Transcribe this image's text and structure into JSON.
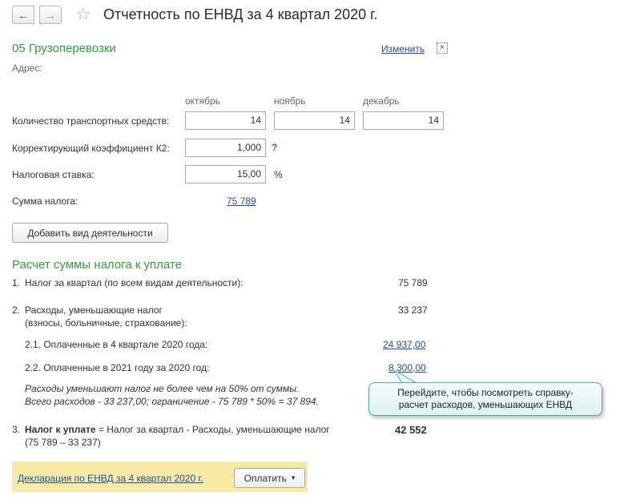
{
  "header": {
    "title": "Отчетность по ЕНВД за 4 квартал 2020 г."
  },
  "activity": {
    "name": "05 Грузоперевозки",
    "change_link": "Изменить",
    "close_glyph": "×",
    "address_label": "Адрес:",
    "months": [
      "октябрь",
      "ноябрь",
      "декабрь"
    ],
    "vehicles_label": "Количество транспортных средств:",
    "vehicles": [
      "14",
      "14",
      "14"
    ],
    "k2_label": "Корректирующий коэффициент К2:",
    "k2_value": "1,000",
    "k2_help": "?",
    "rate_label": "Налоговая ставка:",
    "rate_value": "15,00",
    "rate_unit": "%",
    "tax_sum_label": "Сумма налога:",
    "tax_sum_value": "75 789",
    "add_button": "Добавить вид деятельности"
  },
  "calc": {
    "title": "Расчет суммы налога к уплате",
    "item1_num": "1.",
    "item1_label": "Налог за квартал (по всем видам деятельности):",
    "item1_value": "75 789",
    "item2_num": "2.",
    "item2_label_line1": "Расходы, уменьшающие налог",
    "item2_label_line2": "(взносы, больничные, страхование):",
    "item2_value": "33 237",
    "item21_label": "2.1.  Оплаченные в 4 квартале 2020 года:",
    "item21_value": "24 937,00",
    "item22_label": "2.2.  Оплаченные в 2021 году за 2020 год:",
    "item22_value": "8 300,00",
    "note_line1": "Расходы уменьшают налог не более чем на 50% от суммы.",
    "note_line2": "Всего расходов - 33 237,00; ограничение - 75 789 * 50% = 37 894.",
    "item3_num": "3.",
    "item3_bold": "Налог к уплате",
    "item3_rest": " = Налог за квартал - Расходы, уменьшающие налог",
    "item3_line2": "(75 789 – 33 237)",
    "item3_value": "42 552"
  },
  "tooltip": {
    "line1": "Перейдите, чтобы посмотреть справку-",
    "line2": "расчет расходов, уменьшающих ЕНВД"
  },
  "footer": {
    "declaration_link": "Декларация по ЕНВД за 4 квартал 2020 г.",
    "pay_button": "Оплатить",
    "pay_arrow": "▾"
  }
}
